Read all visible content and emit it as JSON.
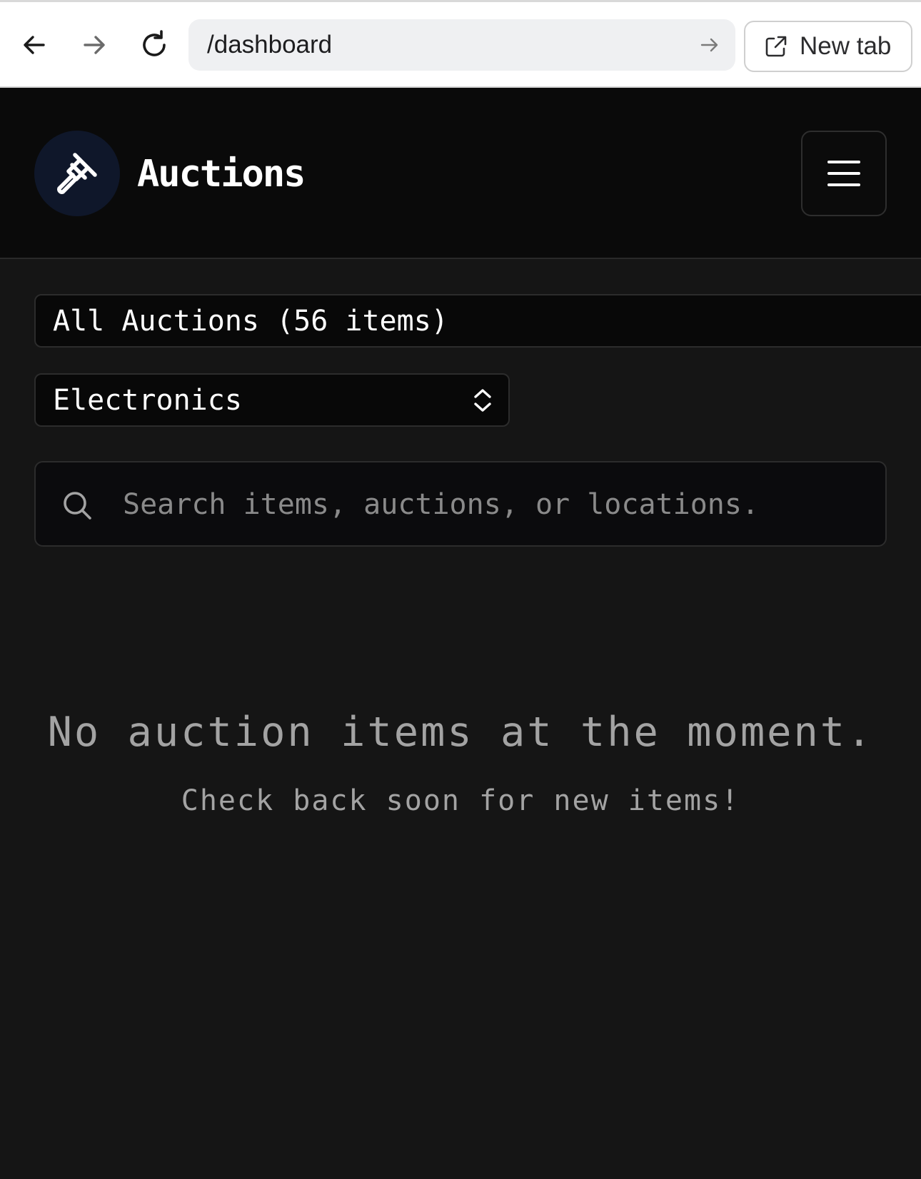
{
  "browser": {
    "address": "/dashboard",
    "new_tab_label": "New tab",
    "icons": {
      "back": "arrow-left-icon",
      "forward": "arrow-right-icon",
      "reload": "reload-icon",
      "go": "arrow-right-icon",
      "new_tab": "external-link-icon"
    }
  },
  "header": {
    "title": "Auctions",
    "logo_icon": "gavel-icon",
    "menu_icon": "hamburger-menu-icon"
  },
  "filters": {
    "auctions_label": "All Auctions (56 items)",
    "category_selected": "Electronics",
    "search_placeholder": "Search items, auctions, or locations."
  },
  "empty_state": {
    "title": "No auction items at the moment.",
    "subtitle": "Check back soon for new items!"
  },
  "colors": {
    "page_background": "#151515",
    "header_background": "#0a0a0a",
    "logo_circle": "#0f172a",
    "text_primary": "#ffffff",
    "text_muted": "#a3a3a3",
    "border": "#2c2c2c"
  }
}
